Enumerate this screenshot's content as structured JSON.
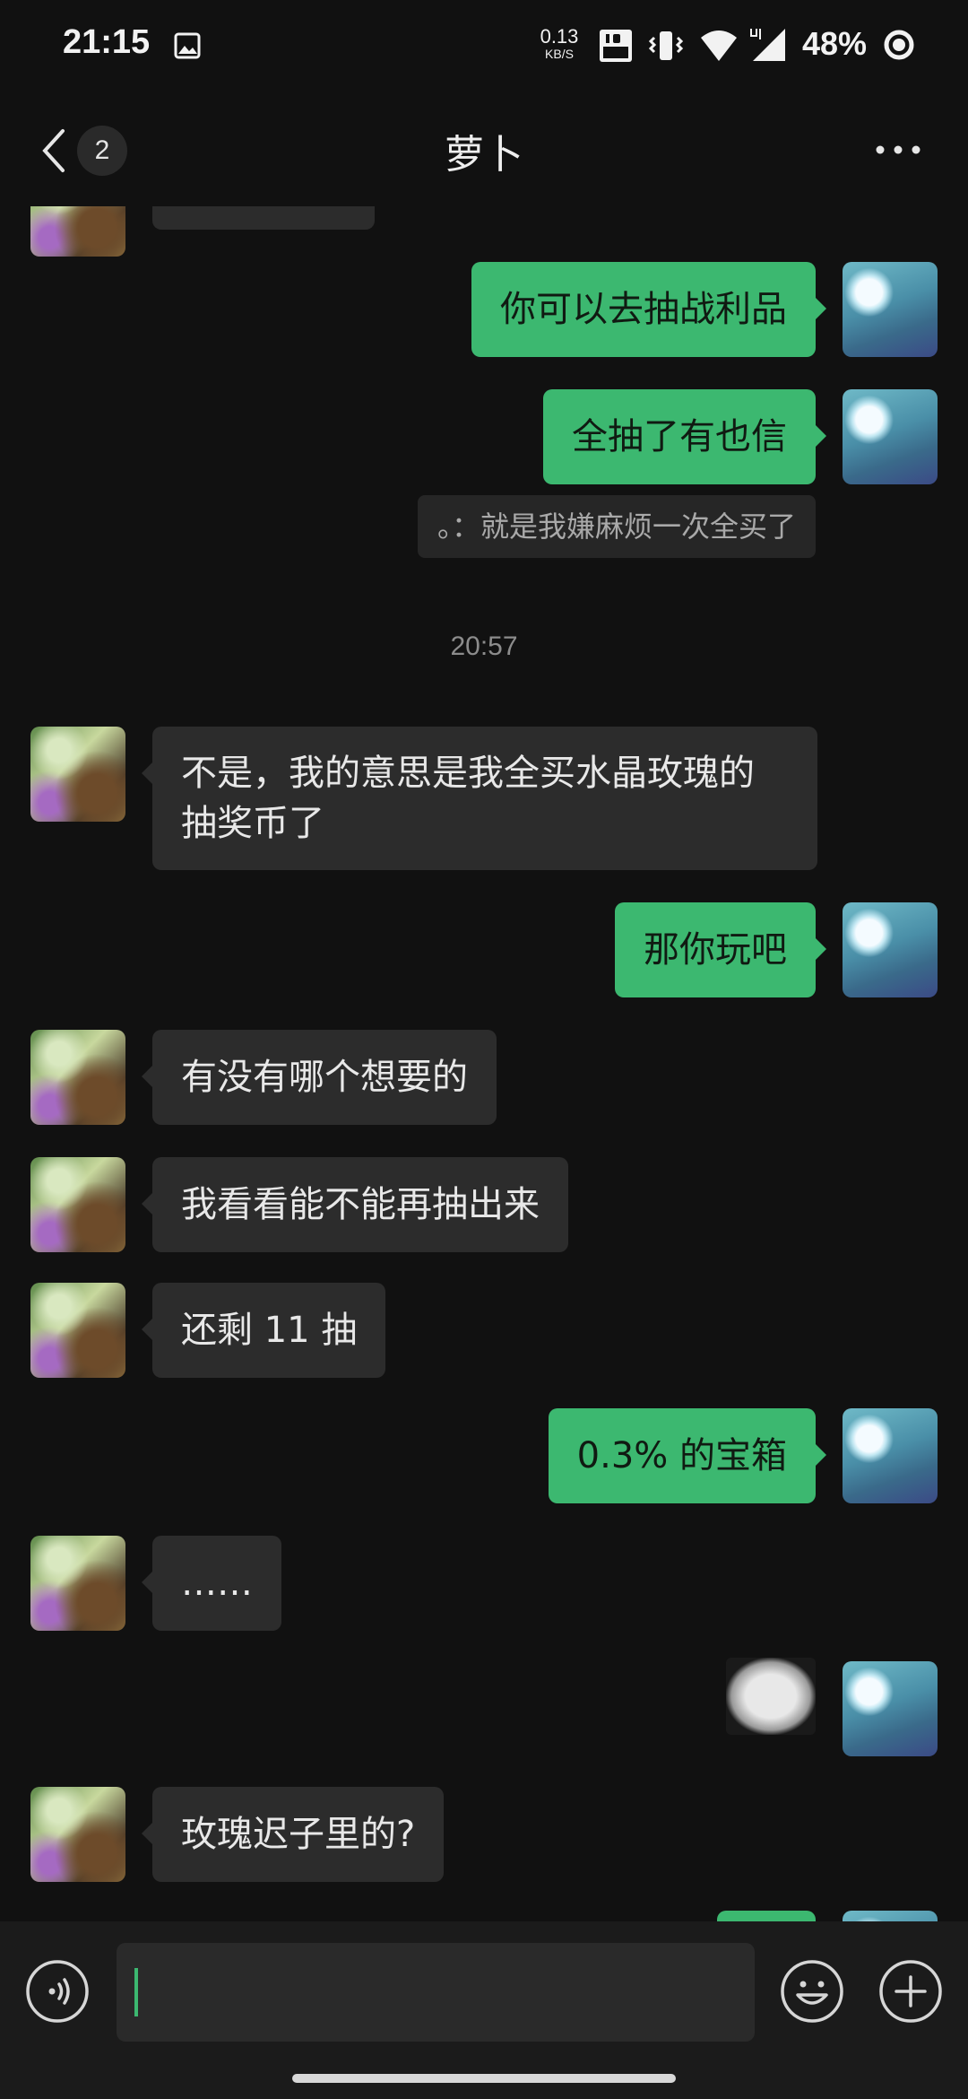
{
  "status_bar": {
    "time": "21:15",
    "net_speed_value": "0.13",
    "net_speed_unit": "KB/S",
    "battery": "48%"
  },
  "header": {
    "title": "萝卜",
    "unread_count": "2"
  },
  "messages": [
    {
      "from": "me",
      "text": "你可以去抽战利品"
    },
    {
      "from": "me",
      "text": "全抽了有也信"
    },
    {
      "type": "quote",
      "text": "。：就是我嫌麻烦一次全买了"
    },
    {
      "type": "time",
      "text": "20:57"
    },
    {
      "from": "peer",
      "text": "不是，我的意思是我全买水晶玫瑰的抽奖币了"
    },
    {
      "from": "me",
      "text": "那你玩吧"
    },
    {
      "from": "peer",
      "text": "有没有哪个想要的"
    },
    {
      "from": "peer",
      "text": "我看看能不能再抽出来"
    },
    {
      "from": "peer",
      "text": "还剩 11 抽"
    },
    {
      "from": "me",
      "text": "0.3% 的宝箱"
    },
    {
      "from": "peer",
      "text": "……"
    },
    {
      "from": "me",
      "type": "sticker"
    },
    {
      "from": "peer",
      "text": "玫瑰迟子里的?"
    }
  ],
  "colors": {
    "background": "#111111",
    "self_bubble": "#3cb870",
    "peer_bubble": "#2c2c2c",
    "input_bar": "#1b1b1b"
  },
  "icons": {
    "back": "chevron-left-icon",
    "more": "more-dots-icon",
    "voice": "voice-icon",
    "emoji": "emoji-icon",
    "plus": "plus-icon"
  }
}
